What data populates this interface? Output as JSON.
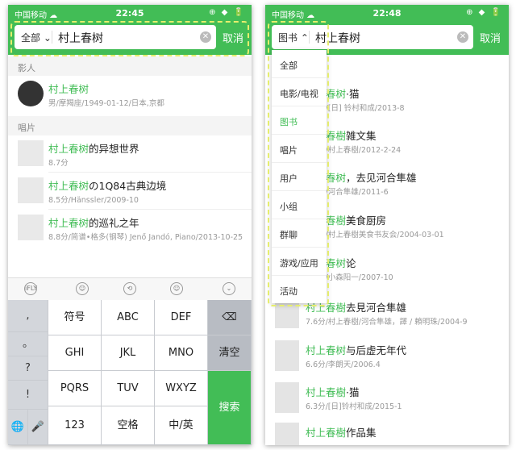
{
  "left": {
    "status": {
      "carrier": "中国移动 ☁",
      "time": "22:45",
      "right": "⊕ ◆ 🔋"
    },
    "search": {
      "scope": "全部 ⌄",
      "query": "村上春树",
      "cancel": "取消"
    },
    "sections": {
      "people": "影人",
      "records": "唱片"
    },
    "person": {
      "name": "村上春树",
      "meta": "男/摩羯座/1949-01-12/日本,京都"
    },
    "records": [
      {
        "hl": "村上春树",
        "rest": "的异想世界",
        "meta": "8.7分"
      },
      {
        "hl": "村上春树",
        "rest": "の1Q84古典边境",
        "meta": "8.5分/Hänssler/2009-10"
      },
      {
        "hl": "村上春树",
        "rest": "的巡礼之年",
        "meta": "8.8分/简谱•格多(钢琴) Jenő Jandó, Piano/2013-10-25"
      }
    ],
    "toolbar": [
      "iFLY",
      "☺",
      "⟲",
      "☺",
      "⌄"
    ],
    "keys": {
      "side": [
        ",",
        "。",
        "?",
        "!"
      ],
      "grid": [
        [
          "符号",
          "ABC",
          "DEF"
        ],
        [
          "GHI",
          "JKL",
          "MNO"
        ],
        [
          "PQRS",
          "TUV",
          "WXYZ"
        ]
      ],
      "backspace": "⌫",
      "clear": "清空",
      "search": "搜索",
      "globe": "🌐",
      "mic": "🎤",
      "num": "123",
      "space": "空格",
      "lang": "中/英"
    }
  },
  "right": {
    "status": {
      "carrier": "中国移动 ☁",
      "time": "22:48",
      "right": "⊕ ◆ 🔋"
    },
    "search": {
      "scope": "图书 ⌃",
      "query": "村上春树",
      "cancel": "取消"
    },
    "dropdown": [
      "全部",
      "电影/电视",
      "图书",
      "唱片",
      "用户",
      "小组",
      "群聊",
      "游戏/应用",
      "活动"
    ],
    "results": [
      {
        "hl": "村上春树",
        "rest": "·猫",
        "meta": "7.1分/[日] 铃村和成/2013-8"
      },
      {
        "hl": "村上春樹",
        "rest": "雑文集",
        "meta": "8.5分/村上春樹/2012-2-24"
      },
      {
        "hl": "村上春树",
        "rest": "，去见河合隼雄",
        "meta": "8.0分/河合隼雄/2011-6"
      },
      {
        "hl": "村上春樹",
        "rest": "美食厨房",
        "meta": "8.6分/村上春樹美食书友会/2004-03-01"
      },
      {
        "hl": "村上春树",
        "rest": "论",
        "meta": "8.1分/小森阳一/2007-10"
      },
      {
        "hl": "村上春樹",
        "rest": "去見河合隼雄",
        "meta": "7.6分/村上春樹/河合隼雄，譯 / 賴明珠/2004-9"
      },
      {
        "hl": "村上春树",
        "rest": "与后虚无年代",
        "meta": "6.6分/李朗天/2006.4"
      },
      {
        "hl": "村上春樹",
        "rest": "·猫",
        "meta": "6.3分/[日]铃村和成/2015-1"
      },
      {
        "hl": "村上春樹",
        "rest": "作品集",
        "meta": ""
      }
    ]
  },
  "colors": {
    "accent": "#42bd56",
    "highlight_dash": "#e6ee6d"
  }
}
